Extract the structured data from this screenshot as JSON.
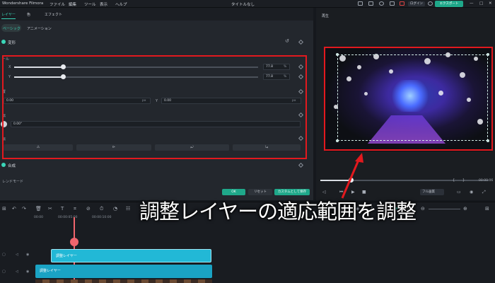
{
  "app": {
    "title": "Wondershare Filmora",
    "doc_title": "タイトルなし",
    "menu": [
      "ファイル",
      "編集",
      "ツール",
      "表示",
      "ヘルプ"
    ],
    "login": "ログイン",
    "export": "エクスポート"
  },
  "tabs": [
    "レイヤー",
    "色",
    "エフェクト"
  ],
  "subtabs": [
    "ベーシック",
    "アニメーション"
  ],
  "transform": {
    "label": "変形",
    "scale_label": "ール",
    "x_label": "X",
    "y_label": "Y",
    "x_value": "77.8",
    "y_value": "77.8",
    "x_unit": "%",
    "y_unit": "%",
    "scale_fraction": 0.78,
    "position_label": "置",
    "pos_x": "0.00",
    "pos_y": "0.00",
    "pos_y_label": "Y",
    "px1": "px",
    "px2": "px",
    "rotate_label": "転",
    "rotate_value": "0.00°",
    "flip_label": "転"
  },
  "composite_label": "合成",
  "blend_label": "レンドモード",
  "footer": {
    "ok": "OK",
    "reset": "リセット",
    "save_custom": "カスタムとして保存"
  },
  "preview": {
    "title": "再生",
    "time": "00:00:06",
    "quality": "フル画質"
  },
  "timeline": {
    "ticks": [
      "00:00",
      "00:00:05:00",
      "00:00:10:00"
    ],
    "track1_clip": "調整レイヤー",
    "track2_clip": "調整レイヤー"
  },
  "caption": "調整レイヤーの適応範囲を調整",
  "colors": {
    "accent": "#3ad6b8",
    "highlight": "#e2191e",
    "clip": "#22b8d6"
  }
}
